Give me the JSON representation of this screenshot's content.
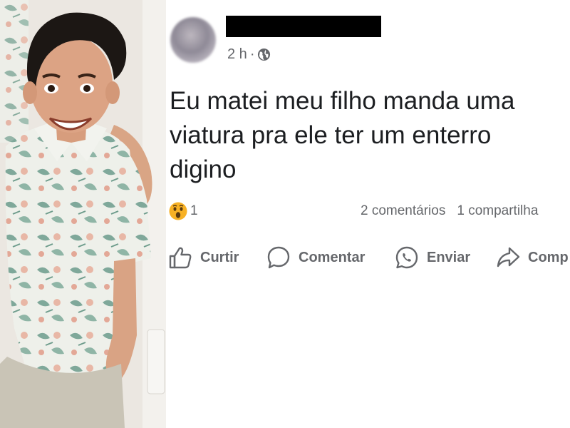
{
  "post": {
    "author_redacted": true,
    "timestamp": "2 h",
    "separator": "·",
    "audience_icon": "globe-icon",
    "text_lines": [
      "Eu matei meu filho manda uma",
      "viatura pra ele ter um enterro",
      "digino"
    ],
    "reaction": {
      "icon": "wow-emoji-icon",
      "count": "1"
    },
    "comments_count": "2 comentários",
    "shares_count": "1 compartilha"
  },
  "actions": {
    "like": "Curtir",
    "comment": "Comentar",
    "send": "Enviar",
    "share": "Comp"
  },
  "colors": {
    "text": "#1c1e21",
    "secondary": "#65676b",
    "background": "#ffffff",
    "wow_emoji": "#f7b125"
  }
}
